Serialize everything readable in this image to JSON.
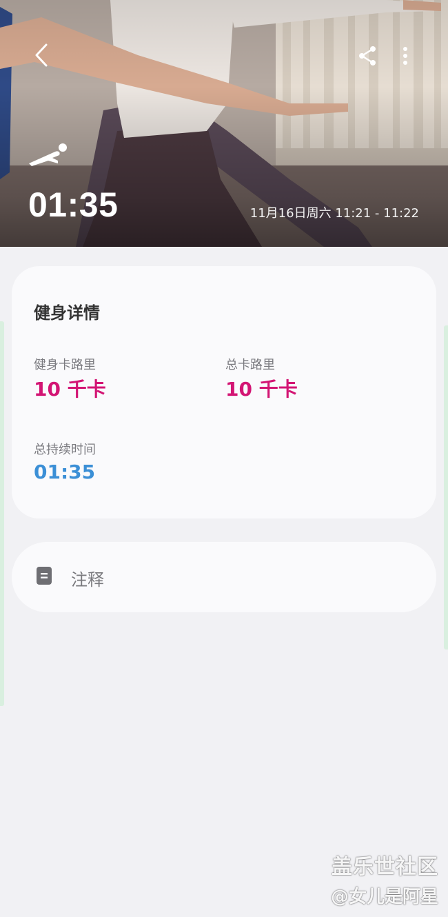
{
  "hero": {
    "duration": "01:35",
    "datetime": "11月16日周六 11:21 - 11:22",
    "icons": {
      "back": "chevron-left-icon",
      "share": "share-icon",
      "more": "more-vertical-icon",
      "workout": "plank-workout-icon"
    }
  },
  "details": {
    "title": "健身详情",
    "workout_calories_label": "健身卡路里",
    "workout_calories_value": "10 千卡",
    "total_calories_label": "总卡路里",
    "total_calories_value": "10 千卡",
    "total_duration_label": "总持续时间",
    "total_duration_value": "01:35"
  },
  "note": {
    "label": "注释",
    "icon": "note-icon"
  },
  "watermark": {
    "line1": "盖乐世社区",
    "line2": "@女儿是阿星"
  },
  "colors": {
    "calorie_accent": "#d31574",
    "duration_accent": "#3b8fd6",
    "background": "#f1f1f4",
    "card": "#fafafc"
  }
}
